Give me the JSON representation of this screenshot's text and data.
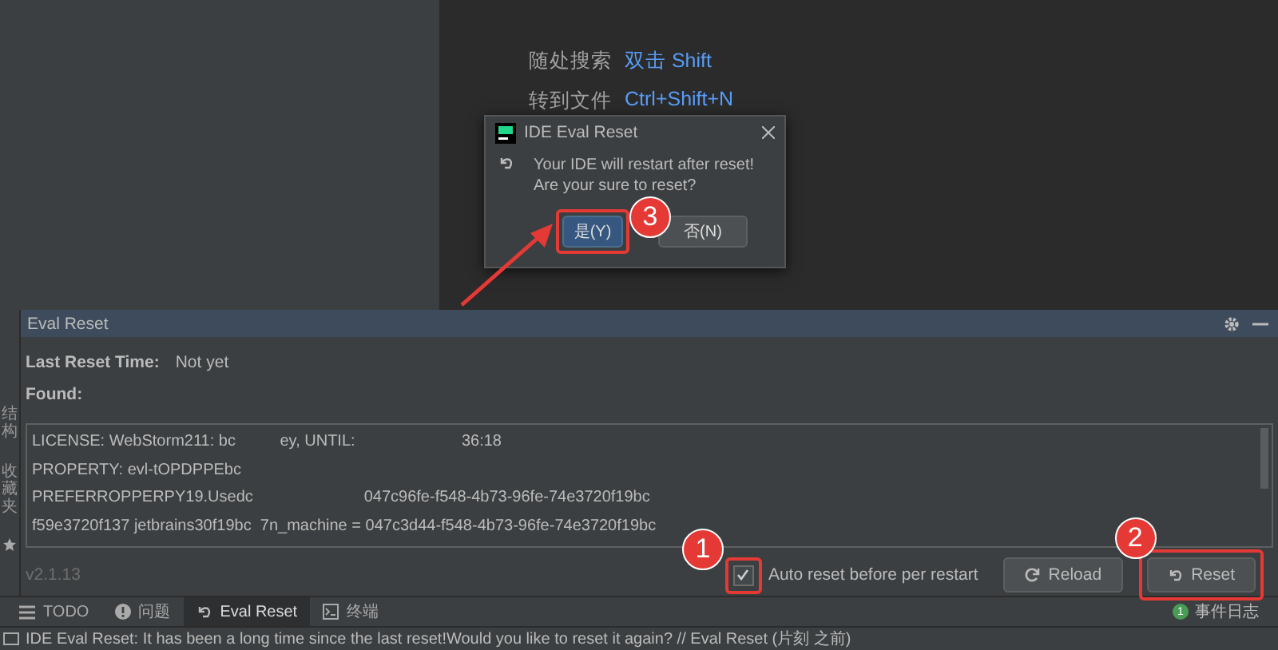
{
  "left_strip": {
    "labels": [
      "结构",
      "收藏夹"
    ]
  },
  "editor": {
    "hints": [
      {
        "label": "随处搜索",
        "shortcut": "双击 Shift"
      },
      {
        "label": "转到文件",
        "shortcut": "Ctrl+Shift+N"
      }
    ]
  },
  "dialog": {
    "title": "IDE Eval Reset",
    "message": [
      "Your IDE will restart after reset!",
      "Are your sure to reset?"
    ],
    "buttons": [
      {
        "label": "是(Y)",
        "selected": true
      },
      {
        "label": "否(N)",
        "selected": false
      }
    ]
  },
  "tool_window": {
    "title": "Eval Reset",
    "last_reset_label": "Last Reset Time:",
    "last_reset_value": "Not yet",
    "found_label": "Found:",
    "found_lines": [
      "LICENSE: WebStorm211: bc          ey, UNTIL:                        36:18",
      "PROPERTY: evl-tOPDPPEbc",
      "PREFERROPPERPY19.Usedc                         047c96fe-f548-4b73-96fe-74e3720f19bc",
      "f59e3720f137 jetbrains30f19bc  7n_machine = 047c3d44-f548-4b73-96fe-74e3720f19bc"
    ],
    "version": "v2.1.13",
    "auto_reset": {
      "label": "Auto reset before per restart",
      "checked": true
    },
    "reload": "Reload",
    "reset": "Reset"
  },
  "tool_tabs": [
    {
      "label": "TODO",
      "kind": "list",
      "selected": false
    },
    {
      "label": "问题",
      "kind": "info",
      "selected": false
    },
    {
      "label": "Eval Reset",
      "kind": "undo",
      "selected": true
    },
    {
      "label": "终端",
      "kind": "terminal",
      "selected": false
    }
  ],
  "event_log": {
    "count": "1",
    "label": "事件日志"
  },
  "status_bar": "IDE Eval Reset: It has been a long time since the last reset!Would you like to reset it again? // Eval Reset (片刻 之前)",
  "annotations": [
    {
      "number": "1"
    },
    {
      "number": "2"
    },
    {
      "number": "3"
    }
  ]
}
